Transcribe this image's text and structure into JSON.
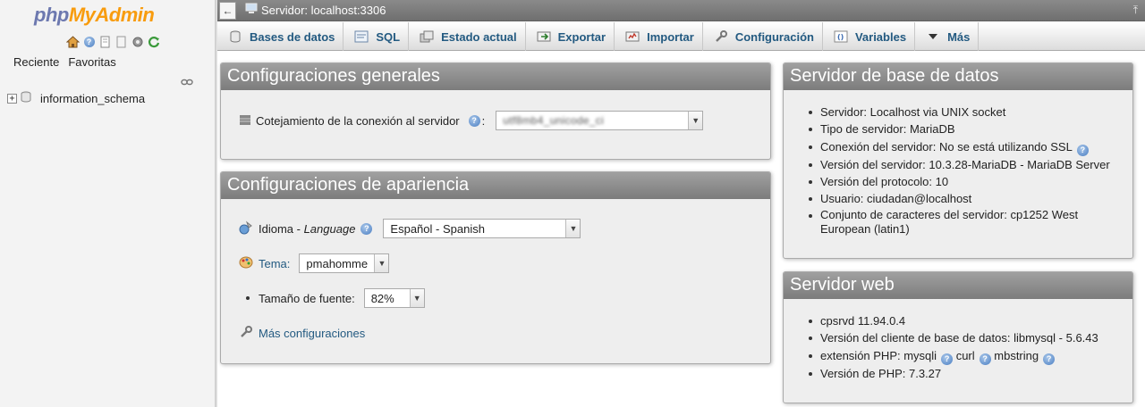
{
  "navigation": {
    "logo_php": "php",
    "logo_my_admin": "MyAdmin",
    "icons": [
      "home-icon",
      "help-icon",
      "docs-icon",
      "settings-icon",
      "reload-icon"
    ],
    "recent_label": "Reciente",
    "favorites_label": "Favoritas",
    "databases": [
      {
        "name": "information_schema"
      }
    ]
  },
  "topbar": {
    "back_label": "←",
    "server_label": "Servidor: localhost:3306",
    "collapse_label": "⤒"
  },
  "tabs": [
    {
      "label": "Bases de datos",
      "icon": "database-icon"
    },
    {
      "label": "SQL",
      "icon": "sql-icon"
    },
    {
      "label": "Estado actual",
      "icon": "status-icon"
    },
    {
      "label": "Exportar",
      "icon": "export-icon"
    },
    {
      "label": "Importar",
      "icon": "import-icon"
    },
    {
      "label": "Configuración",
      "icon": "wrench-icon"
    },
    {
      "label": "Variables",
      "icon": "variables-icon"
    },
    {
      "label": "Más",
      "icon": "chevron-down-icon"
    }
  ],
  "general_settings": {
    "title": "Configuraciones generales",
    "collation_label": "Cotejamiento de la conexión al servidor",
    "collation_colon": ":",
    "collation_value": "utf8mb4_unicode_ci"
  },
  "appearance_settings": {
    "title": "Configuraciones de apariencia",
    "language_label": "Idioma - ",
    "language_label_em": "Language",
    "language_value": "Español - Spanish",
    "theme_label": "Tema:",
    "theme_value": "pmahomme",
    "font_size_label": "Tamaño de fuente:",
    "font_size_value": "82%",
    "more_settings_label": "Más configuraciones"
  },
  "db_server": {
    "title": "Servidor de base de datos",
    "items": [
      "Servidor: Localhost via UNIX socket",
      "Tipo de servidor: MariaDB",
      "Conexión del servidor: No se está utilizando SSL",
      "Versión del servidor: 10.3.28-MariaDB - MariaDB Server",
      "Versión del protocolo: 10",
      "Usuario: ciudadan@localhost",
      "Conjunto de caracteres del servidor: cp1252 West European (latin1)"
    ]
  },
  "web_server": {
    "title": "Servidor web",
    "items": [
      "cpsrvd 11.94.0.4",
      "Versión del cliente de base de datos: libmysql - 5.6.43"
    ],
    "php_ext_label": "extensión PHP: mysqli",
    "php_ext_curl": "curl",
    "php_ext_mbstring": "mbstring",
    "php_version": "Versión de PHP: 7.3.27"
  },
  "colors": {
    "link": "#235a81",
    "panel_header": "#8a8a8a",
    "logo_php": "#6c78af",
    "logo_myadmin": "#f89c0e"
  }
}
